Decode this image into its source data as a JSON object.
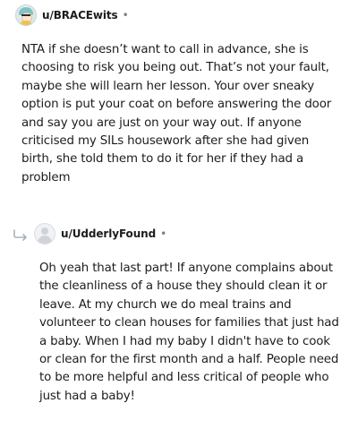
{
  "comments": [
    {
      "username": "u/BRACEwits",
      "separator": "•",
      "avatar_icon": "user-avatar-icon",
      "body": "NTA if she doesn’t want to call in advance, she is choosing to risk you being out. That’s not your fault, maybe she will learn her lesson. Your over sneaky option is put your coat on before answering the door and say you are just on your way out. If anyone criticised my SILs housework after she had given birth, she told them to do it for her if they had a problem"
    },
    {
      "username": "u/UdderlyFound",
      "separator": "•",
      "avatar_icon": "default-avatar-icon",
      "reply_icon": "reply-arrow-icon",
      "body": "Oh yeah that last part! If anyone complains about the cleanliness of a house they should clean it or leave. At my church we do meal trains and volunteer to clean houses for families that just had a baby. When I had my baby I didn't have to cook or clean for the first month and a half. People need to be more helpful and less critical of people who just had a baby!"
    }
  ],
  "colors": {
    "text": "#1c1c1c",
    "meta": "#7c7c7c",
    "reply_arrow": "#a9b3bd",
    "background": "#ffffff"
  }
}
